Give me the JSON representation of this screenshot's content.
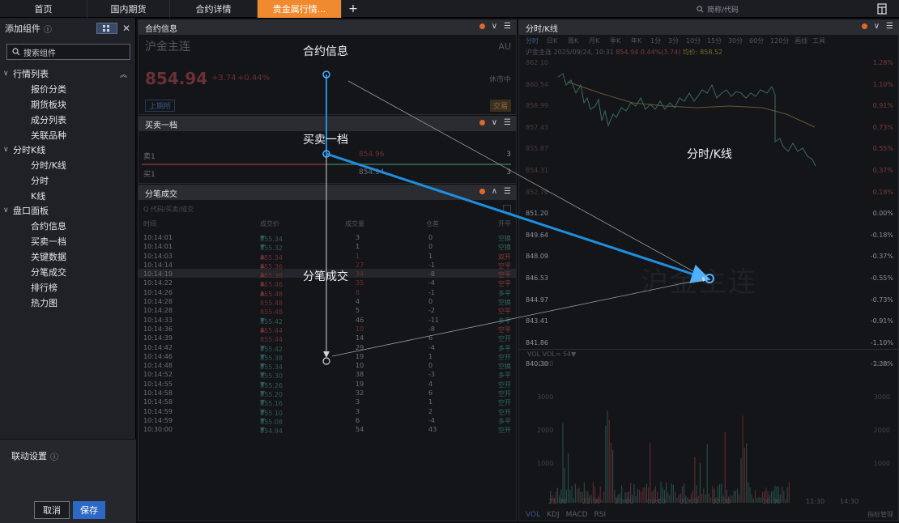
{
  "topbar": {
    "tabs": [
      {
        "label": "首页",
        "active": false
      },
      {
        "label": "国内期货",
        "active": false
      },
      {
        "label": "合约详情",
        "active": false
      },
      {
        "label": "贵金属行情...",
        "active": true
      }
    ],
    "add_tab": "+",
    "search_placeholder": "简称/代码"
  },
  "sidebar": {
    "title": "添加组件",
    "search_placeholder": "搜索组件",
    "groups": [
      {
        "label": "行情列表",
        "items": [
          "报价分类",
          "期货板块",
          "成分列表",
          "关联品种"
        ]
      },
      {
        "label": "分时K线",
        "items": [
          "分时/K线",
          "分时",
          "K线"
        ]
      },
      {
        "label": "盘口面板",
        "items": [
          "合约信息",
          "买卖一档",
          "关键数据",
          "分笔成交",
          "排行榜",
          "热力图"
        ]
      }
    ],
    "link_settings": "联动设置",
    "cancel": "取消",
    "save": "保存"
  },
  "contract": {
    "title": "合约信息",
    "name": "沪金主连",
    "code": "AU",
    "price": "854.94",
    "change": "+3.74",
    "pct": "+0.44%",
    "status": "休市中",
    "badge_left": "上期所",
    "badge_right": "交易"
  },
  "bidask": {
    "title": "买卖一档",
    "rows": [
      {
        "label": "卖1",
        "price": "854.96",
        "vol": "3"
      },
      {
        "label": "买1",
        "price": "854.94",
        "vol": "3"
      }
    ]
  },
  "trades": {
    "title": "分笔成交",
    "search_placeholder": "代码/买卖/成交",
    "headers": [
      "时间",
      "成交价",
      "成交量",
      "仓差",
      "开平"
    ],
    "rows": [
      {
        "time": "10:14:01",
        "price": "855.34",
        "dir": "down",
        "vol": "3",
        "oi": "0",
        "type": "空换",
        "tcls": "gr"
      },
      {
        "time": "10:14:01",
        "price": "855.32",
        "dir": "down",
        "vol": "1",
        "oi": "0",
        "type": "空换",
        "tcls": "gr"
      },
      {
        "time": "10:14:03",
        "price": "855.34",
        "dir": "up",
        "vol": "1",
        "oi": "1",
        "type": "双开",
        "tcls": "rd"
      },
      {
        "time": "10:14:14",
        "price": "855.36",
        "dir": "up",
        "vol": "27",
        "oi": "-1",
        "type": "空平",
        "tcls": "rd"
      },
      {
        "time": "10:14:19",
        "price": "855.38",
        "dir": "up",
        "vol": "34",
        "oi": "-8",
        "type": "空平",
        "tcls": "rd",
        "hl": true
      },
      {
        "time": "10:14:22",
        "price": "855.46",
        "dir": "up",
        "vol": "35",
        "oi": "-4",
        "type": "空平",
        "tcls": "rd"
      },
      {
        "time": "10:14:26",
        "price": "855.48",
        "dir": "up",
        "vol": "8",
        "oi": "-1",
        "type": "多平",
        "tcls": "gr"
      },
      {
        "time": "10:14:28",
        "price": "855.48",
        "dir": "",
        "vol": "4",
        "oi": "0",
        "type": "空换",
        "tcls": "gr"
      },
      {
        "time": "10:14:28",
        "price": "855.48",
        "dir": "",
        "vol": "5",
        "oi": "-2",
        "type": "空平",
        "tcls": "rd"
      },
      {
        "time": "10:14:33",
        "price": "855.42",
        "dir": "down",
        "vol": "46",
        "oi": "-11",
        "type": "多平",
        "tcls": "gr"
      },
      {
        "time": "10:14:36",
        "price": "855.44",
        "dir": "up",
        "vol": "10",
        "oi": "-8",
        "type": "空平",
        "tcls": "rd"
      },
      {
        "time": "10:14:39",
        "price": "855.44",
        "dir": "",
        "vol": "14",
        "oi": "6",
        "type": "空开",
        "tcls": "gr"
      },
      {
        "time": "10:14:42",
        "price": "855.42",
        "dir": "down",
        "vol": "29",
        "oi": "-4",
        "type": "多平",
        "tcls": "gr"
      },
      {
        "time": "10:14:46",
        "price": "855.38",
        "dir": "down",
        "vol": "19",
        "oi": "1",
        "type": "空开",
        "tcls": "gr"
      },
      {
        "time": "10:14:48",
        "price": "855.34",
        "dir": "down",
        "vol": "10",
        "oi": "0",
        "type": "空换",
        "tcls": "gr"
      },
      {
        "time": "10:14:52",
        "price": "855.30",
        "dir": "down",
        "vol": "38",
        "oi": "-3",
        "type": "多平",
        "tcls": "gr"
      },
      {
        "time": "10:14:55",
        "price": "855.26",
        "dir": "down",
        "vol": "19",
        "oi": "4",
        "type": "空开",
        "tcls": "gr"
      },
      {
        "time": "10:14:58",
        "price": "855.20",
        "dir": "down",
        "vol": "32",
        "oi": "6",
        "type": "空开",
        "tcls": "gr"
      },
      {
        "time": "10:14:58",
        "price": "855.16",
        "dir": "down",
        "vol": "3",
        "oi": "1",
        "type": "空开",
        "tcls": "gr"
      },
      {
        "time": "10:14:59",
        "price": "855.10",
        "dir": "down",
        "vol": "3",
        "oi": "2",
        "type": "空开",
        "tcls": "gr"
      },
      {
        "time": "10:14:59",
        "price": "855.08",
        "dir": "down",
        "vol": "6",
        "oi": "-4",
        "type": "多平",
        "tcls": "gr"
      },
      {
        "time": "10:30:00",
        "price": "854.94",
        "dir": "down",
        "vol": "54",
        "oi": "43",
        "type": "空开",
        "tcls": "gr"
      }
    ]
  },
  "kline": {
    "title": "分时/K线",
    "tabs": [
      "分时",
      "日K",
      "周K",
      "月K",
      "季K",
      "年K",
      "1分",
      "3分",
      "10分",
      "15分",
      "30分",
      "60分",
      "120分",
      "画线",
      "工具"
    ],
    "info_name": "沪金主连",
    "info_time": "2025/09/24, 10:31",
    "info_price": "854.94",
    "info_change": "0.44%(3.74)",
    "info_avg": "均价: 858.52",
    "left_axis": [
      "862.10",
      "860.54",
      "858.99",
      "857.43",
      "855.87",
      "854.31",
      "852.76",
      "851.20",
      "849.64",
      "848.09",
      "846.53",
      "844.97",
      "843.41",
      "841.86",
      "840.30"
    ],
    "right_axis": [
      "1.28%",
      "1.10%",
      "0.91%",
      "0.73%",
      "0.55%",
      "0.37%",
      "0.18%",
      "0.00%",
      "-0.18%",
      "-0.37%",
      "-0.55%",
      "-0.73%",
      "-0.91%",
      "-1.10%",
      "-1.28%"
    ],
    "vol_label": "VOL VOL= 54▼",
    "vol_axis": [
      "4000",
      "3000",
      "2000",
      "1000"
    ],
    "time_axis": [
      "21:00",
      "22:00",
      "23:00",
      "00:00",
      "01:00",
      "02:00",
      "10:00",
      "11:30",
      "14:30"
    ],
    "indicators": [
      "VOL",
      "KDJ",
      "MACD",
      "RSI"
    ],
    "manage": "指标管理",
    "watermark": "沪金主连"
  },
  "annotations": {
    "contract": "合约信息",
    "bidask": "买卖一档",
    "trades": "分笔成交",
    "kline": "分时/K线"
  },
  "colors": {
    "accent_tab": "#f08a2e",
    "save_button": "#2d68c4",
    "arrow": "#1f8fe0"
  }
}
